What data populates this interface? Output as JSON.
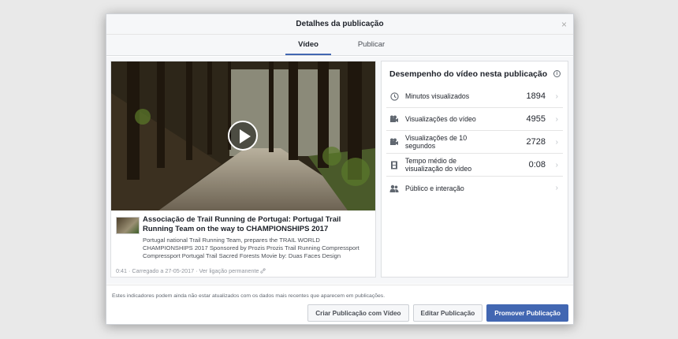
{
  "dialog": {
    "title": "Detalhes da publicação",
    "close_label": "×"
  },
  "tabs": [
    {
      "label": "Vídeo",
      "active": true
    },
    {
      "label": "Publicar",
      "active": false
    }
  ],
  "post": {
    "title": "Associação de Trail Running de Portugal: Portugal Trail Running Team on the way to CHAMPIONSHIPS 2017",
    "description": "Portugal national Trail Running Team, prepares the TRAIL WORLD CHAMPIONSHIPS 2017 Sponsored by Prozis Prozis Trail Running Compressport Compressport Portugal Trail Sacred Forests Movie by: Duas Faces Design",
    "duration": "0:41",
    "uploaded": "Carregado a 27-05-2017",
    "permalink": "Ver ligação permanente",
    "separator": "·"
  },
  "performance": {
    "title": "Desempenho do vídeo nesta publicação",
    "info_icon": "i",
    "metrics": [
      {
        "label": "Minutos visualizados",
        "value": "1894",
        "icon": "clock-icon"
      },
      {
        "label": "Visualizações do vídeo",
        "value": "4955",
        "icon": "video-camera-icon"
      },
      {
        "label": "Visualizações de 10 segundos",
        "value": "2728",
        "icon": "video-camera-icon"
      },
      {
        "label": "Tempo médio de visualização do vídeo",
        "value": "0:08",
        "icon": "film-icon"
      },
      {
        "label": "Público e interação",
        "value": "",
        "icon": "people-icon"
      }
    ]
  },
  "disclaimer": "Estes indicadores podem ainda não estar atualizados com os dados mais recentes que aparecem em publicações.",
  "buttons": {
    "create": "Criar Publicação com Vídeo",
    "edit": "Editar Publicação",
    "promote": "Promover Publicação"
  },
  "colors": {
    "accent": "#4267b2",
    "panel_bg": "#f6f7f9"
  }
}
